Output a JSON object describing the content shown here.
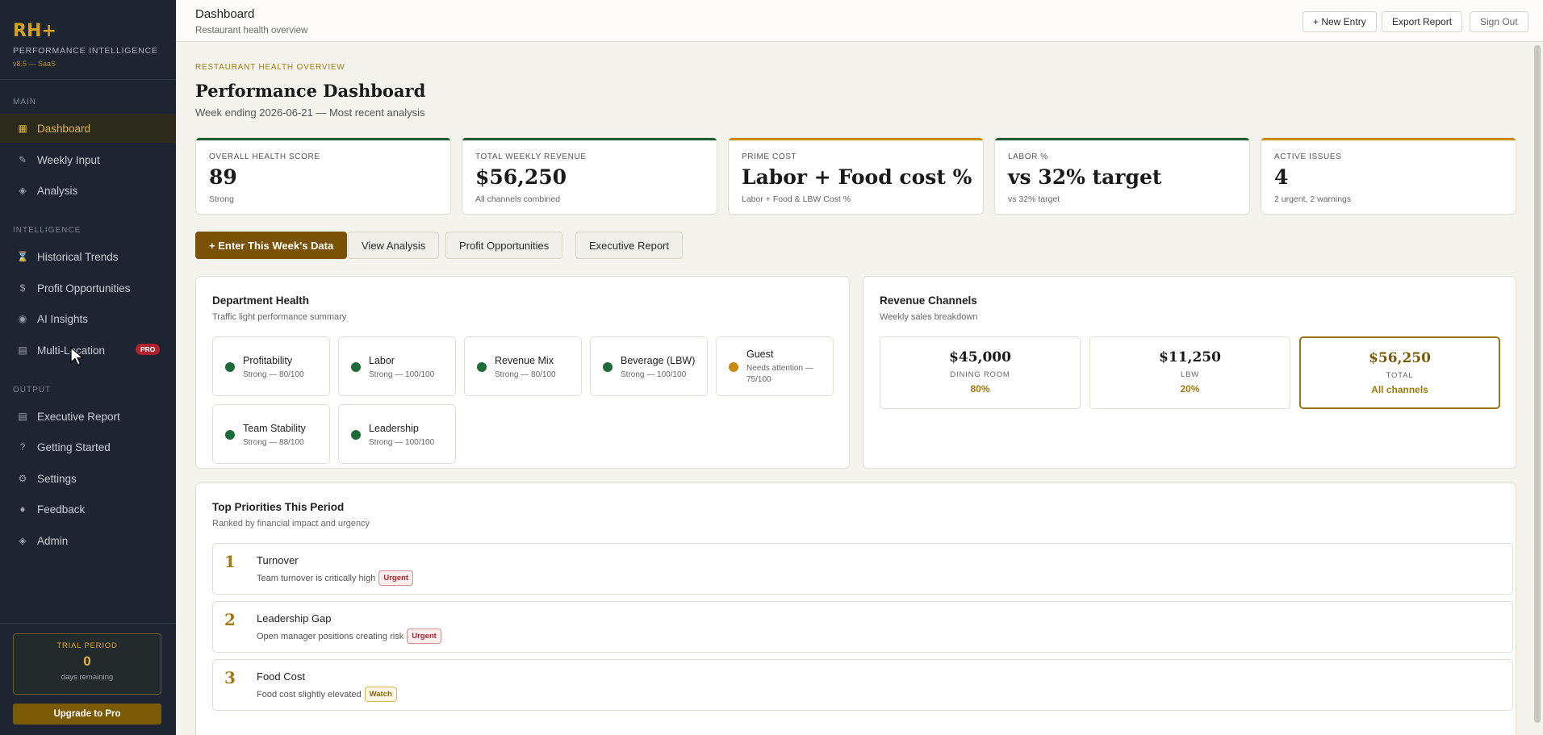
{
  "sidebar": {
    "logo": "RH+",
    "subtitle": "PERFORMANCE INTELLIGENCE",
    "version": "v8.5 — SaaS",
    "sections": {
      "main": "MAIN",
      "intelligence": "INTELLIGENCE",
      "output": "OUTPUT"
    },
    "items": [
      {
        "label": "Dashboard",
        "icon": "grid-icon"
      },
      {
        "label": "Weekly Input",
        "icon": "pencil-icon"
      },
      {
        "label": "Analysis",
        "icon": "diamond-icon"
      },
      {
        "label": "Historical Trends",
        "icon": "hourglass-icon"
      },
      {
        "label": "Profit Opportunities",
        "icon": "dollar-icon"
      },
      {
        "label": "AI Insights",
        "icon": "target-icon"
      },
      {
        "label": "Multi-Location",
        "icon": "layout-icon",
        "badge": "PRO"
      },
      {
        "label": "Executive Report",
        "icon": "report-icon"
      },
      {
        "label": "Getting Started",
        "icon": "question-icon"
      },
      {
        "label": "Settings",
        "icon": "gear-icon"
      },
      {
        "label": "Feedback",
        "icon": "chat-icon"
      },
      {
        "label": "Admin",
        "icon": "diamond-icon"
      }
    ],
    "trial": {
      "label": "TRIAL PERIOD",
      "days": "0",
      "sub": "days remaining"
    },
    "upgrade_label": "Upgrade to Pro"
  },
  "topbar": {
    "title": "Dashboard",
    "subtitle": "Restaurant health overview",
    "new_entry": "+ New Entry",
    "export": "Export Report",
    "sign_out": "Sign Out"
  },
  "main": {
    "kicker": "RESTAURANT HEALTH OVERVIEW",
    "title": "Performance Dashboard",
    "subtitle": "Week ending 2026-06-21 — Most recent analysis",
    "kpis": [
      {
        "label": "OVERALL HEALTH SCORE",
        "value": "89",
        "sub": "Strong",
        "accent": "#1e5b34"
      },
      {
        "label": "TOTAL WEEKLY REVENUE",
        "value": "$56,250",
        "sub": "All channels combined",
        "accent": "#1e5b34"
      },
      {
        "label": "PRIME COST",
        "value": "Labor + Food cost %",
        "sub": "Labor + Food & LBW Cost %",
        "accent": "#c88a10"
      },
      {
        "label": "LABOR %",
        "value": "vs 32% target",
        "sub": "vs 32% target",
        "accent": "#1e5b34"
      },
      {
        "label": "ACTIVE ISSUES",
        "value": "4",
        "sub": "2 urgent, 2 warnings",
        "accent": "#c88a10"
      }
    ],
    "actions": [
      "+ Enter This Week's Data",
      "View Analysis",
      "Profit Opportunities",
      "Executive Report"
    ],
    "dept_health": {
      "title": "Department Health",
      "subtitle": "Traffic light performance summary",
      "items": [
        {
          "name": "Profitability",
          "status": "Strong — 80/100",
          "color": "#1e6b3a"
        },
        {
          "name": "Labor",
          "status": "Strong — 100/100",
          "color": "#1e6b3a"
        },
        {
          "name": "Revenue Mix",
          "status": "Strong — 80/100",
          "color": "#1e6b3a"
        },
        {
          "name": "Beverage (LBW)",
          "status": "Strong — 100/100",
          "color": "#1e6b3a"
        },
        {
          "name": "Guest",
          "status": "Needs attention — 75/100",
          "color": "#c88a10"
        },
        {
          "name": "Team Stability",
          "status": "Strong — 88/100",
          "color": "#1e6b3a"
        },
        {
          "name": "Leadership",
          "status": "Strong — 100/100",
          "color": "#1e6b3a"
        }
      ]
    },
    "revenue": {
      "title": "Revenue Channels",
      "subtitle": "Weekly sales breakdown",
      "channels": [
        {
          "amount": "$45,000",
          "label": "DINING ROOM",
          "pct": "80%"
        },
        {
          "amount": "$11,250",
          "label": "LBW",
          "pct": "20%"
        },
        {
          "amount": "$56,250",
          "label": "TOTAL",
          "pct": "All channels"
        }
      ]
    },
    "priorities": {
      "title": "Top Priorities This Period",
      "subtitle": "Ranked by financial impact and urgency",
      "items": [
        {
          "num": "1",
          "title": "Turnover",
          "desc": "Team turnover is critically high",
          "tag": "Urgent"
        },
        {
          "num": "2",
          "title": "Leadership Gap",
          "desc": "Open manager positions creating risk",
          "tag": "Urgent"
        },
        {
          "num": "3",
          "title": "Food Cost",
          "desc": "Food cost slightly elevated",
          "tag": "Watch"
        }
      ]
    }
  }
}
